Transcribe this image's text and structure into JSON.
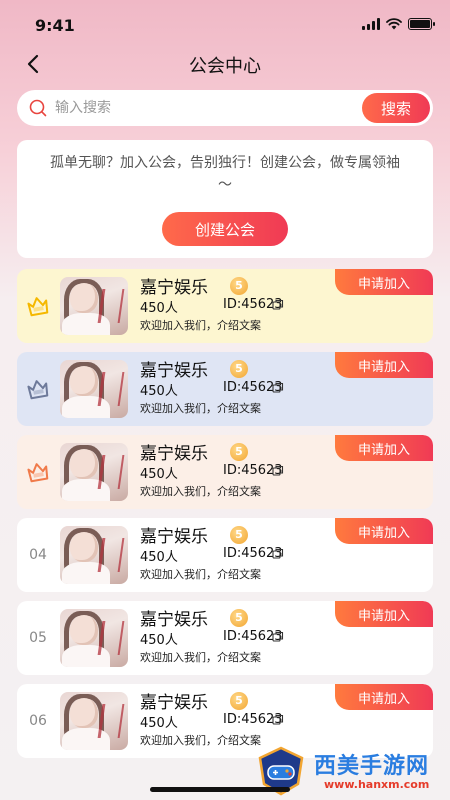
{
  "status_bar": {
    "time": "9:41"
  },
  "header": {
    "title": "公会中心"
  },
  "search": {
    "placeholder": "输入搜索",
    "button_label": "搜索"
  },
  "intro": {
    "text": "孤单无聊？加入公会，告别独行！创建公会，做专属领袖～",
    "create_button": "创建公会"
  },
  "guilds": [
    {
      "rank_type": "icon",
      "rank_icon": "rank-1-badge-icon",
      "rank_color": "#f5b800",
      "bg": "#fdf6d0",
      "name": "嘉宁娱乐",
      "level": "5",
      "members": "450人",
      "id": "ID:45623",
      "desc": "欢迎加入我们，介绍文案",
      "apply": "申请加入"
    },
    {
      "rank_type": "icon",
      "rank_icon": "rank-2-badge-icon",
      "rank_color": "#6e7a9a",
      "bg": "#dfe5f4",
      "name": "嘉宁娱乐",
      "level": "5",
      "members": "450人",
      "id": "ID:45623",
      "desc": "欢迎加入我们，介绍文案",
      "apply": "申请加入"
    },
    {
      "rank_type": "icon",
      "rank_icon": "rank-3-badge-icon",
      "rank_color": "#f07a4a",
      "bg": "#fcefe7",
      "name": "嘉宁娱乐",
      "level": "5",
      "members": "450人",
      "id": "ID:45623",
      "desc": "欢迎加入我们，介绍文案",
      "apply": "申请加入"
    },
    {
      "rank_type": "number",
      "rank": "04",
      "bg": "#ffffff",
      "name": "嘉宁娱乐",
      "level": "5",
      "members": "450人",
      "id": "ID:45623",
      "desc": "欢迎加入我们，介绍文案",
      "apply": "申请加入"
    },
    {
      "rank_type": "number",
      "rank": "05",
      "bg": "#ffffff",
      "name": "嘉宁娱乐",
      "level": "5",
      "members": "450人",
      "id": "ID:45623",
      "desc": "欢迎加入我们，介绍文案",
      "apply": "申请加入"
    },
    {
      "rank_type": "number",
      "rank": "06",
      "bg": "#ffffff",
      "name": "嘉宁娱乐",
      "level": "5",
      "members": "450人",
      "id": "ID:45623",
      "desc": "欢迎加入我们，介绍文案",
      "apply": "申请加入"
    }
  ],
  "watermark": {
    "title": "西美手游网",
    "url": "www.hanxm.com"
  },
  "colors": {
    "accent": "#f03a55",
    "accent_start": "#ff6a4a"
  }
}
